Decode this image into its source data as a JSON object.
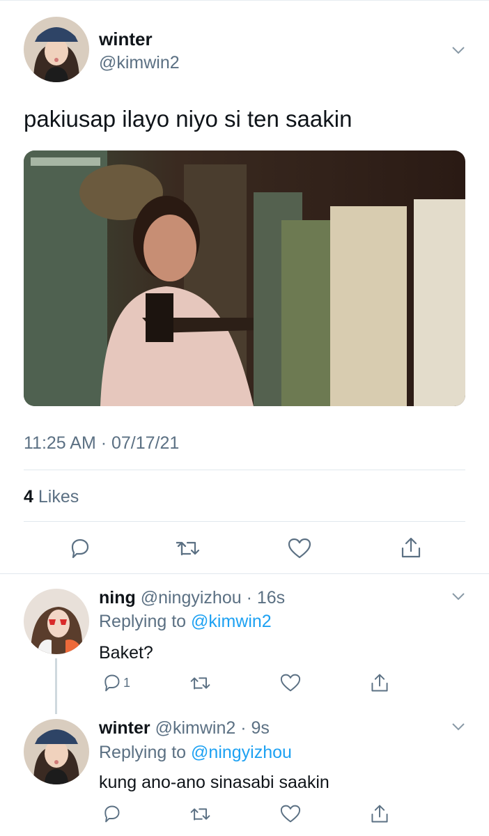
{
  "main_tweet": {
    "display_name": "winter",
    "handle": "@kimwin2",
    "text": "pakiusap ilayo niyo si ten saakin",
    "timestamp": "11:25 AM · 07/17/21",
    "likes_count": "4",
    "likes_label": "Likes"
  },
  "replies": [
    {
      "display_name": "ning",
      "handle": "@ningyizhou",
      "time": "· 16s",
      "replying_label": "Replying to",
      "replying_to": "@kimwin2",
      "text": "Baket?",
      "reply_count": "1"
    },
    {
      "display_name": "winter",
      "handle": "@kimwin2",
      "time": "· 9s",
      "replying_label": "Replying to",
      "replying_to": "@ningyizhou",
      "text": "kung ano-ano sinasabi saakin",
      "reply_count": ""
    }
  ],
  "icons": [
    "chevron-down-icon",
    "reply-icon",
    "retweet-icon",
    "like-icon",
    "share-icon"
  ],
  "colors": {
    "link": "#1da1f2",
    "secondary": "#5b7083",
    "divider": "#e1e8ed"
  }
}
